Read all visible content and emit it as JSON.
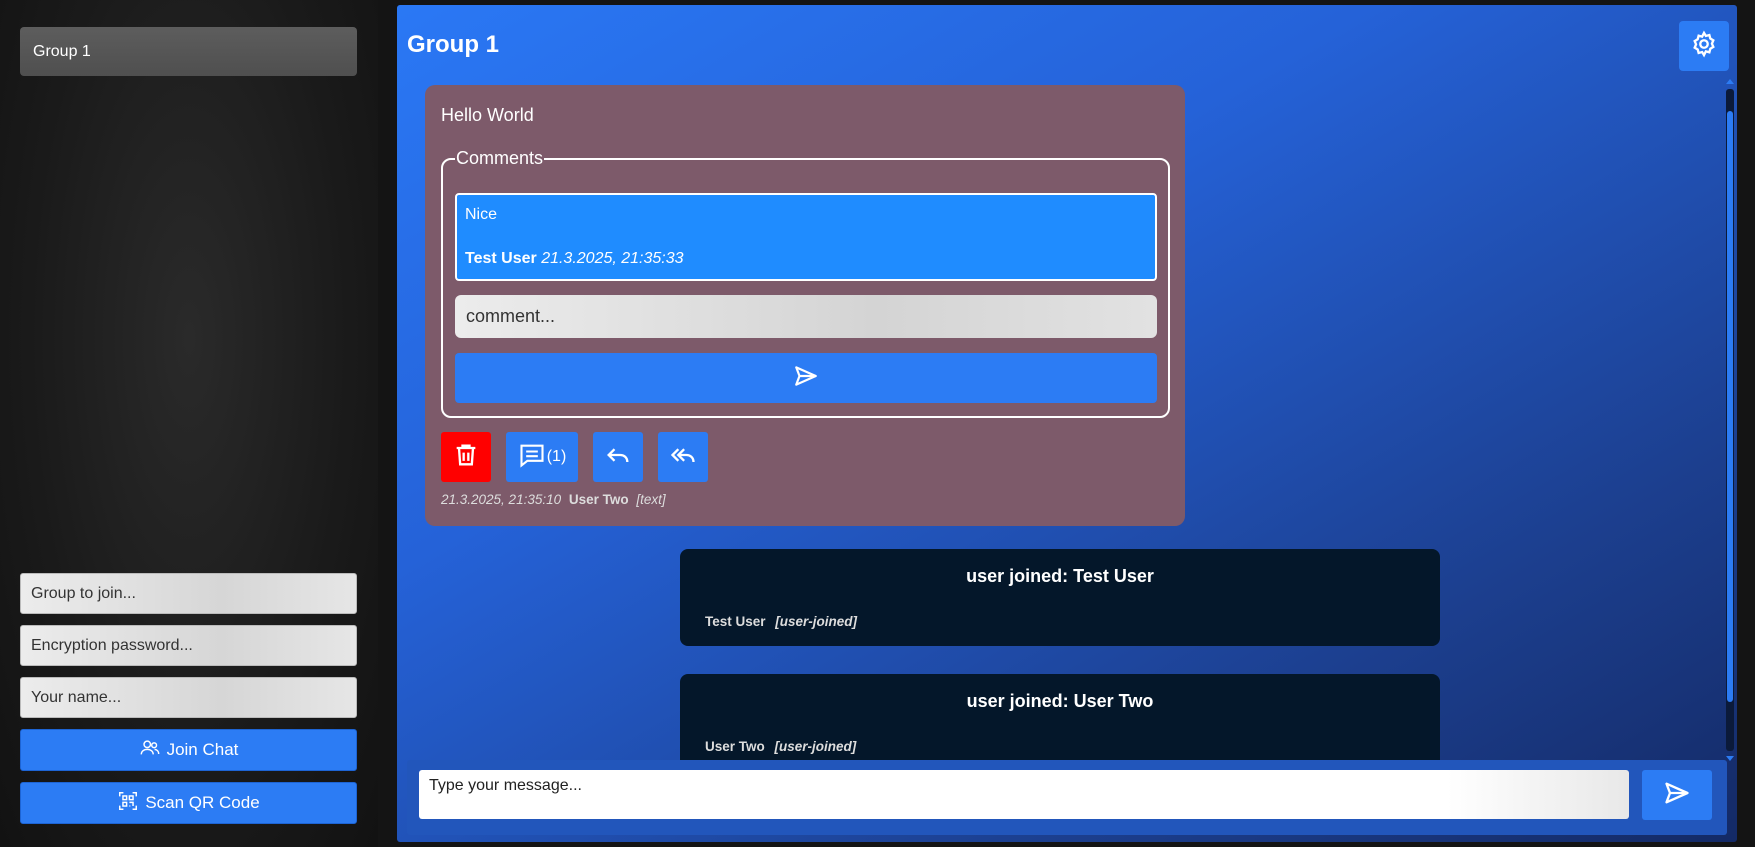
{
  "sidebar": {
    "groups": [
      {
        "label": "Group 1"
      }
    ],
    "join_form": {
      "group_placeholder": "Group to join...",
      "password_placeholder": "Encryption password...",
      "name_placeholder": "Your name...",
      "join_label": "Join Chat",
      "scan_label": "Scan QR Code"
    }
  },
  "chat": {
    "title": "Group 1",
    "messages": [
      {
        "text": "Hello World",
        "comments_legend": "Comments",
        "comments": [
          {
            "text": "Nice",
            "author": "Test User",
            "time": "21.3.2025, 21:35:33"
          }
        ],
        "comment_placeholder": "comment...",
        "comment_count": "(1)",
        "meta": {
          "time": "21.3.2025, 21:35:10",
          "user": "User Two",
          "kind": "[text]"
        }
      }
    ],
    "system_messages": [
      {
        "title": "user joined: Test User",
        "user": "Test User",
        "kind": "[user-joined]"
      },
      {
        "title": "user joined: User Two",
        "user": "User Two",
        "kind": "[user-joined]"
      }
    ],
    "composer": {
      "placeholder": "Type your message..."
    }
  },
  "icons": {
    "settings": "gear-icon",
    "send": "send-icon",
    "delete": "trash-icon",
    "comments": "comment-icon",
    "reply": "reply-icon",
    "reply_all": "reply-all-icon",
    "join": "users-icon",
    "scan": "qr-code-icon"
  },
  "colors": {
    "accent": "#2c7cf4",
    "danger": "#ff0000",
    "message_bg": "#7d5a6a",
    "comment_bg": "#1f8cff",
    "system_bg": "#04172a"
  }
}
